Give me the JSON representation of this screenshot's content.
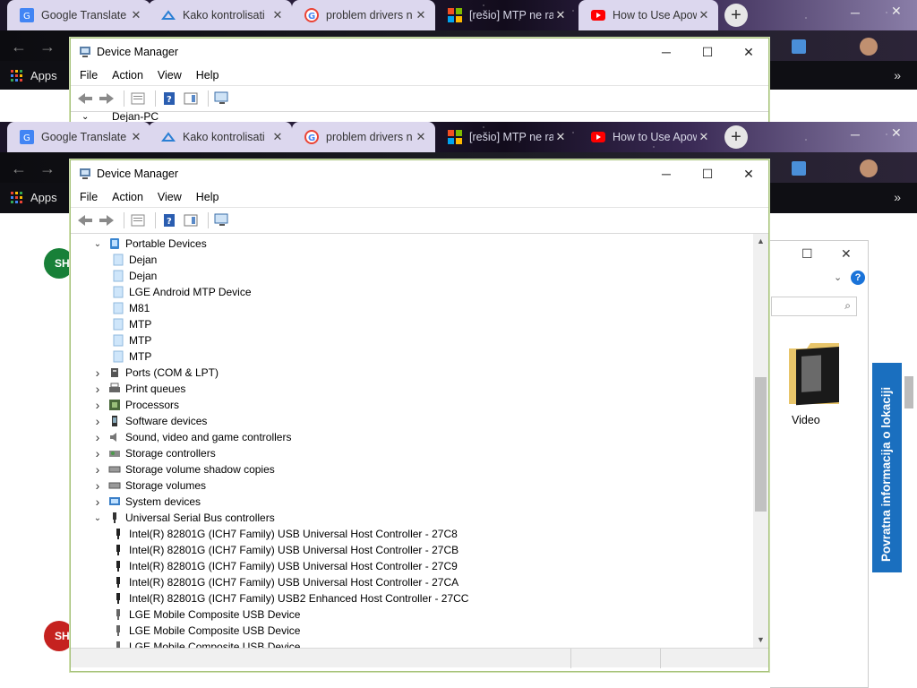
{
  "browser": {
    "tabs": [
      {
        "label": "Google Translate",
        "icon": "google-translate-icon",
        "style": "light"
      },
      {
        "label": "Kako kontrolisati",
        "icon": "cloud-site-icon",
        "style": "light"
      },
      {
        "label": "problem drivers n",
        "icon": "google-icon",
        "style": "light"
      },
      {
        "label": "[rešio] MTP ne ra",
        "icon": "windows-forum-icon",
        "style": "dark"
      },
      {
        "label": "How to Use Apow",
        "icon": "youtube-icon",
        "style": "light"
      }
    ],
    "tabs_second": [
      {
        "label": "Google Translate",
        "icon": "google-translate-icon",
        "style": "light"
      },
      {
        "label": "Kako kontrolisati",
        "icon": "cloud-site-icon",
        "style": "light"
      },
      {
        "label": "problem drivers n",
        "icon": "google-icon",
        "style": "light"
      },
      {
        "label": "[rešio] MTP ne ra",
        "icon": "windows-forum-icon",
        "style": "dark"
      },
      {
        "label": "How to Use Apow",
        "icon": "youtube-icon",
        "style": "dark"
      }
    ],
    "new_tab": "+",
    "apps_label": "Apps",
    "overflow": "»"
  },
  "device_manager_back": {
    "title": "Device Manager",
    "root_partial": "Dejan-PC"
  },
  "device_manager": {
    "title": "Device Manager",
    "menu": [
      "File",
      "Action",
      "View",
      "Help"
    ],
    "tree": [
      {
        "label": "Portable Devices",
        "level": 0,
        "expanded": true,
        "icon": "portable-devices-icon"
      },
      {
        "label": "Dejan",
        "level": 1,
        "icon": "portable-device-icon"
      },
      {
        "label": "Dejan",
        "level": 1,
        "icon": "portable-device-icon"
      },
      {
        "label": "LGE Android MTP Device",
        "level": 1,
        "icon": "portable-device-icon"
      },
      {
        "label": "M81",
        "level": 1,
        "icon": "portable-device-icon"
      },
      {
        "label": "MTP",
        "level": 1,
        "icon": "portable-device-icon"
      },
      {
        "label": "MTP",
        "level": 1,
        "icon": "portable-device-icon"
      },
      {
        "label": "MTP",
        "level": 1,
        "icon": "portable-device-icon"
      },
      {
        "label": "Ports (COM & LPT)",
        "level": 0,
        "expanded": false,
        "icon": "port-icon"
      },
      {
        "label": "Print queues",
        "level": 0,
        "expanded": false,
        "icon": "printer-icon"
      },
      {
        "label": "Processors",
        "level": 0,
        "expanded": false,
        "icon": "processor-icon"
      },
      {
        "label": "Software devices",
        "level": 0,
        "expanded": false,
        "icon": "software-device-icon"
      },
      {
        "label": "Sound, video and game controllers",
        "level": 0,
        "expanded": false,
        "icon": "speaker-icon"
      },
      {
        "label": "Storage controllers",
        "level": 0,
        "expanded": false,
        "icon": "storage-controller-icon"
      },
      {
        "label": "Storage volume shadow copies",
        "level": 0,
        "expanded": false,
        "icon": "drive-icon"
      },
      {
        "label": "Storage volumes",
        "level": 0,
        "expanded": false,
        "icon": "drive-icon"
      },
      {
        "label": "System devices",
        "level": 0,
        "expanded": false,
        "icon": "system-device-icon"
      },
      {
        "label": "Universal Serial Bus controllers",
        "level": 0,
        "expanded": true,
        "icon": "usb-icon"
      },
      {
        "label": "Intel(R) 82801G (ICH7 Family) USB Universal Host Controller - 27C8",
        "level": 1,
        "icon": "usb-plug-icon"
      },
      {
        "label": "Intel(R) 82801G (ICH7 Family) USB Universal Host Controller - 27CB",
        "level": 1,
        "icon": "usb-plug-icon"
      },
      {
        "label": "Intel(R) 82801G (ICH7 Family) USB Universal Host Controller - 27C9",
        "level": 1,
        "icon": "usb-plug-icon"
      },
      {
        "label": "Intel(R) 82801G (ICH7 Family) USB Universal Host Controller - 27CA",
        "level": 1,
        "icon": "usb-plug-icon"
      },
      {
        "label": "Intel(R) 82801G (ICH7 Family) USB2 Enhanced Host Controller - 27CC",
        "level": 1,
        "icon": "usb-plug-icon"
      },
      {
        "label": "LGE Mobile Composite USB Device",
        "level": 1,
        "icon": "usb-plug-gray-icon"
      },
      {
        "label": "LGE Mobile Composite USB Device",
        "level": 1,
        "icon": "usb-plug-gray-icon"
      },
      {
        "label": "LGE Mobile Composite USB Device",
        "level": 1,
        "icon": "usb-plug-gray-icon"
      }
    ]
  },
  "explorer": {
    "folder_label": "Video",
    "help": "?"
  },
  "location_banner": "Povratna informacija o lokaciji",
  "avatars": [
    "SH",
    "SH"
  ],
  "colors": {
    "window_border": "#a6c27a",
    "location_banner": "#1a6fbf",
    "avatar_green": "#188038",
    "avatar_red": "#c5221f"
  }
}
